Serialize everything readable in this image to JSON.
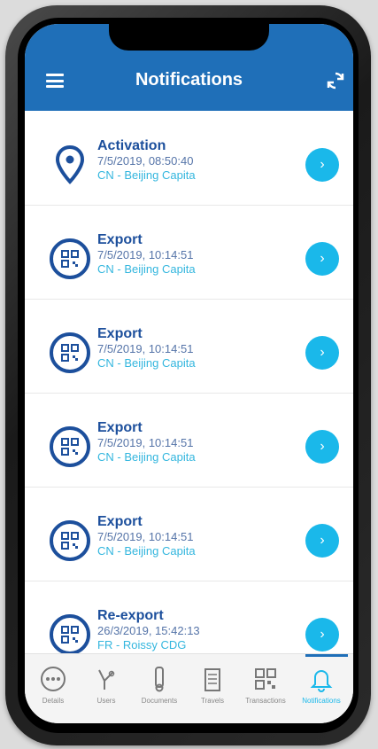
{
  "header": {
    "title": "Notifications",
    "menu_icon": "menu-icon",
    "refresh_icon": "refresh-icon"
  },
  "notifications": [
    {
      "title": "Activation",
      "date": "7/5/2019, 08:50:40",
      "location": "CN - Beijing Capita",
      "icon": "location-pin-icon"
    },
    {
      "title": "Export",
      "date": "7/5/2019, 10:14:51",
      "location": "CN - Beijing Capita",
      "icon": "qr-code-icon"
    },
    {
      "title": "Export",
      "date": "7/5/2019, 10:14:51",
      "location": "CN - Beijing Capita",
      "icon": "qr-code-icon"
    },
    {
      "title": "Export",
      "date": "7/5/2019, 10:14:51",
      "location": "CN - Beijing Capita",
      "icon": "qr-code-icon"
    },
    {
      "title": "Export",
      "date": "7/5/2019, 10:14:51",
      "location": "CN - Beijing Capita",
      "icon": "qr-code-icon"
    },
    {
      "title": "Re-export",
      "date": "26/3/2019, 15:42:13",
      "location": "FR - Roissy CDG",
      "icon": "qr-code-icon"
    }
  ],
  "tabs": [
    {
      "label": "Details",
      "icon": "details-icon"
    },
    {
      "label": "Users",
      "icon": "users-icon"
    },
    {
      "label": "Documents",
      "icon": "documents-icon"
    },
    {
      "label": "Travels",
      "icon": "travels-icon"
    },
    {
      "label": "Transactions",
      "icon": "transactions-icon"
    },
    {
      "label": "Notifications",
      "icon": "bell-icon",
      "active": true
    }
  ],
  "colors": {
    "header": "#1f6fb8",
    "accent": "#1ab8ea",
    "title": "#1c4f9c"
  }
}
